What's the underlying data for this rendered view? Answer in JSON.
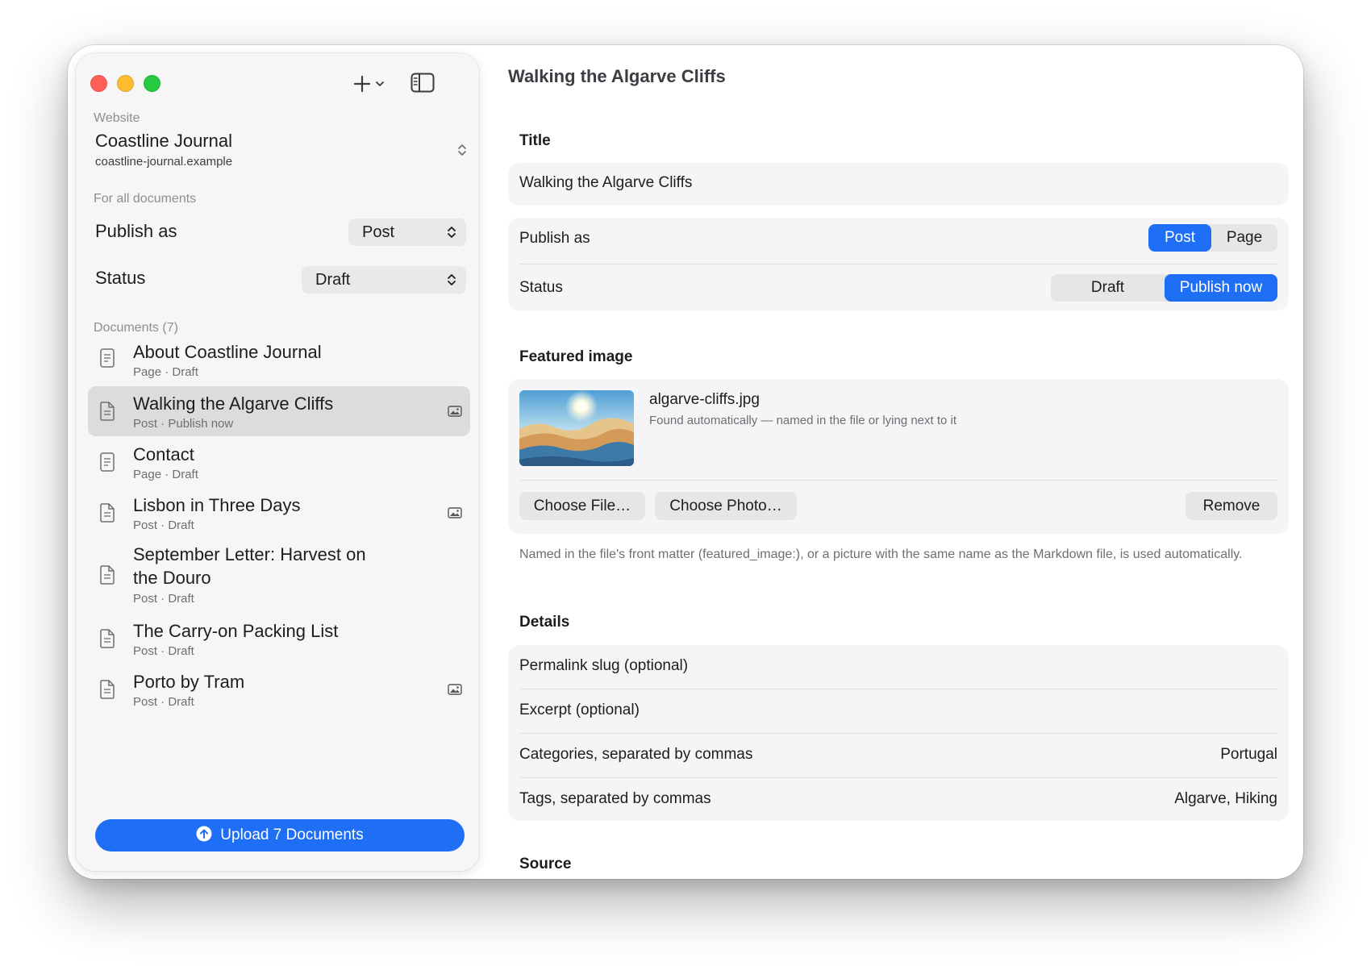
{
  "sidebar": {
    "website_label": "Website",
    "site_name": "Coastline Journal",
    "site_url": "coastline-journal.example",
    "for_all_label": "For all documents",
    "publish_as_label": "Publish as",
    "publish_as_value": "Post",
    "status_label": "Status",
    "status_value": "Draft",
    "documents_label": "Documents (7)",
    "documents": [
      {
        "title": "About Coastline Journal",
        "subtitle": "Page · Draft"
      },
      {
        "title": "Walking the Algarve Cliffs",
        "subtitle": "Post · Publish now"
      },
      {
        "title": "Contact",
        "subtitle": "Page · Draft"
      },
      {
        "title": "Lisbon in Three Days",
        "subtitle": "Post · Draft"
      },
      {
        "title": "September Letter: Harvest on the Douro",
        "subtitle": "Post · Draft"
      },
      {
        "title": "The Carry-on Packing List",
        "subtitle": "Post · Draft"
      },
      {
        "title": "Porto by Tram",
        "subtitle": "Post · Draft"
      }
    ],
    "upload_label": "Upload 7 Documents"
  },
  "main": {
    "title": "Walking the Algarve Cliffs",
    "title_section": "Title",
    "title_value": "Walking the Algarve Cliffs",
    "publish_as_label": "Publish as",
    "publish_as_options": [
      "Post",
      "Page"
    ],
    "publish_as_selected": "Post",
    "status_label": "Status",
    "status_options": [
      "Draft",
      "Publish now"
    ],
    "status_selected": "Publish now",
    "featured_section": "Featured image",
    "image_filename": "algarve-cliffs.jpg",
    "image_caption": "Found automatically — named in the file or lying next to it",
    "choose_file": "Choose File…",
    "choose_photo": "Choose Photo…",
    "remove": "Remove",
    "featured_note": "Named in the file's front matter (featured_image:), or a picture with the same name as the Markdown file, is used automatically.",
    "details_section": "Details",
    "slug_label": "Permalink slug (optional)",
    "excerpt_label": "Excerpt (optional)",
    "categories_label": "Categories, separated by commas",
    "categories_value": "Portugal",
    "tags_label": "Tags, separated by commas",
    "tags_value": "Algarve, Hiking",
    "source_section": "Source"
  },
  "colors": {
    "accent": "#1e6ff5",
    "close": "#ff5f57",
    "minimize": "#febc2e",
    "zoom": "#28c840"
  },
  "icons": [
    "plus-icon",
    "chevron-down-icon",
    "sidebar-toggle-icon",
    "updown-chevron-icon",
    "page-document-icon",
    "post-document-icon",
    "image-icon",
    "upload-arrow-icon"
  ]
}
